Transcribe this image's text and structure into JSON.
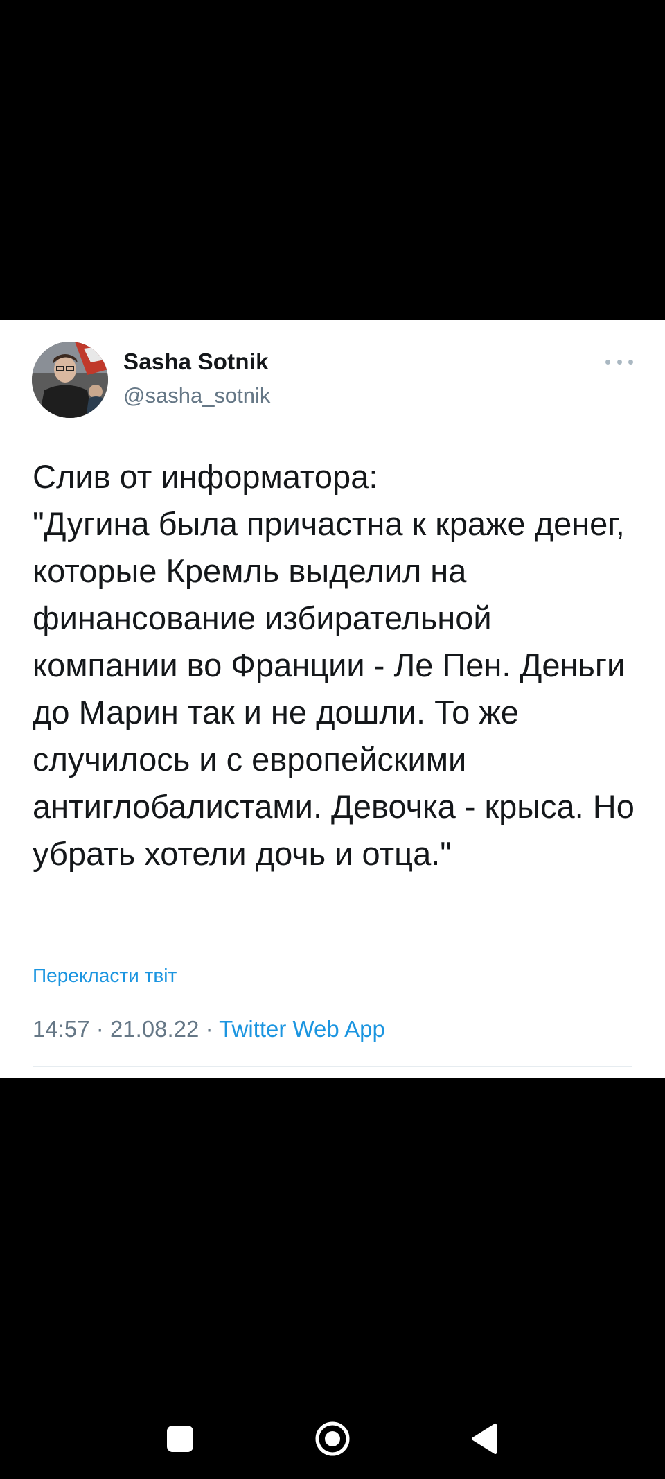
{
  "tweet": {
    "author": {
      "display_name": "Sasha Sotnik",
      "handle": "@sasha_sotnik"
    },
    "text": "Слив от информатора:\n\"Дугина была причастна к краже денег, которые Кремль выделил на финансование избирательной компании во Франции - Ле Пен. Деньги до Марин так и не дошли. То же случилось и с европейскими антиглобалистами. Девочка - крыса. Но убрать хотели дочь и отца.\"",
    "translate_label": "Перекласти твіт",
    "time": "14:57",
    "date": "21.08.22",
    "separator": "·",
    "source": "Twitter Web App"
  },
  "icons": {
    "more": "more-horizontal-icon",
    "recents": "recents-square-icon",
    "home": "home-circle-icon",
    "back": "back-triangle-icon"
  },
  "colors": {
    "text_primary": "#14171a",
    "text_secondary": "#657786",
    "link": "#1b95e0",
    "background": "#ffffff",
    "screen": "#000000"
  }
}
